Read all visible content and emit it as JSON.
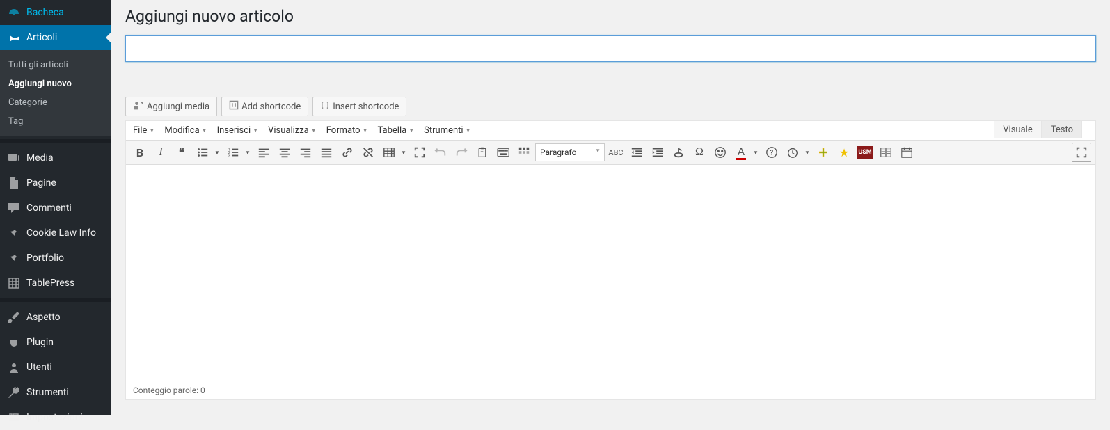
{
  "sidebar": {
    "items": [
      {
        "label": "Bacheca",
        "icon": "dashboard"
      },
      {
        "label": "Articoli",
        "icon": "pin",
        "active": true
      },
      {
        "label": "Media",
        "icon": "media"
      },
      {
        "label": "Pagine",
        "icon": "page"
      },
      {
        "label": "Commenti",
        "icon": "comment"
      },
      {
        "label": "Cookie Law Info",
        "icon": "pin2"
      },
      {
        "label": "Portfolio",
        "icon": "pin2"
      },
      {
        "label": "TablePress",
        "icon": "table"
      },
      {
        "label": "Aspetto",
        "icon": "brush"
      },
      {
        "label": "Plugin",
        "icon": "plug"
      },
      {
        "label": "Utenti",
        "icon": "user"
      },
      {
        "label": "Strumenti",
        "icon": "wrench"
      },
      {
        "label": "Impostazioni",
        "icon": "settings"
      }
    ],
    "submenu": [
      {
        "label": "Tutti gli articoli"
      },
      {
        "label": "Aggiungi nuovo",
        "current": true
      },
      {
        "label": "Categorie"
      },
      {
        "label": "Tag"
      }
    ]
  },
  "page": {
    "title": "Aggiungi nuovo articolo"
  },
  "title_input": {
    "value": "",
    "placeholder": ""
  },
  "media_buttons": {
    "add_media": "Aggiungi media",
    "add_shortcode": "Add shortcode",
    "insert_shortcode": "Insert shortcode"
  },
  "editor_tabs": {
    "visual": "Visuale",
    "text": "Testo"
  },
  "menu_bar": [
    "File",
    "Modifica",
    "Inserisci",
    "Visualizza",
    "Formato",
    "Tabella",
    "Strumenti"
  ],
  "format_select": {
    "value": "Paragrafo"
  },
  "status_bar": {
    "word_count": "Conteggio parole: 0"
  },
  "colors": {
    "accent": "#0073aa",
    "sidebar": "#23282d"
  }
}
